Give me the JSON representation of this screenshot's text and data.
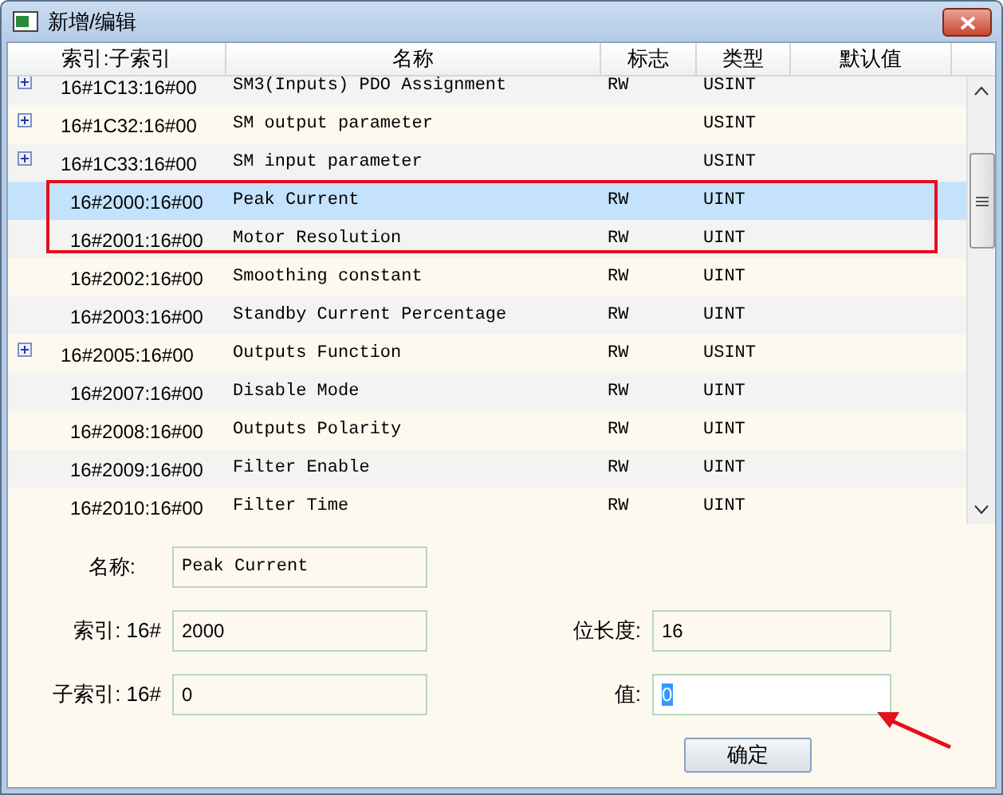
{
  "window": {
    "title": "新增/编辑"
  },
  "table": {
    "columns": [
      "索引:子索引",
      "名称",
      "标志",
      "类型",
      "默认值"
    ],
    "rows": [
      {
        "index": "16#1C13:16#00",
        "name": "SM3(Inputs) PDO Assignment",
        "flag": "RW",
        "type": "USINT",
        "expandable": true,
        "selected": false
      },
      {
        "index": "16#1C32:16#00",
        "name": "SM output parameter",
        "flag": "",
        "type": "USINT",
        "expandable": true,
        "selected": false
      },
      {
        "index": "16#1C33:16#00",
        "name": "SM input parameter",
        "flag": "",
        "type": "USINT",
        "expandable": true,
        "selected": false
      },
      {
        "index": "16#2000:16#00",
        "name": "Peak Current",
        "flag": "RW",
        "type": "UINT",
        "expandable": false,
        "selected": true
      },
      {
        "index": "16#2001:16#00",
        "name": "Motor Resolution",
        "flag": "RW",
        "type": "UINT",
        "expandable": false,
        "selected": false
      },
      {
        "index": "16#2002:16#00",
        "name": "Smoothing constant",
        "flag": "RW",
        "type": "UINT",
        "expandable": false,
        "selected": false
      },
      {
        "index": "16#2003:16#00",
        "name": "Standby Current Percentage",
        "flag": "RW",
        "type": "UINT",
        "expandable": false,
        "selected": false
      },
      {
        "index": "16#2005:16#00",
        "name": "Outputs Function",
        "flag": "RW",
        "type": "USINT",
        "expandable": true,
        "selected": false
      },
      {
        "index": "16#2007:16#00",
        "name": "Disable Mode",
        "flag": "RW",
        "type": "UINT",
        "expandable": false,
        "selected": false
      },
      {
        "index": "16#2008:16#00",
        "name": "Outputs Polarity",
        "flag": "RW",
        "type": "UINT",
        "expandable": false,
        "selected": false
      },
      {
        "index": "16#2009:16#00",
        "name": "Filter Enable",
        "flag": "RW",
        "type": "UINT",
        "expandable": false,
        "selected": false
      },
      {
        "index": "16#2010:16#00",
        "name": "Filter Time",
        "flag": "RW",
        "type": "UINT",
        "expandable": false,
        "selected": false
      }
    ]
  },
  "form": {
    "name_label": "名称:",
    "name_value": "Peak Current",
    "index_label": "索引: 16#",
    "index_value": "2000",
    "subindex_label": "子索引: 16#",
    "subindex_value": "0",
    "bitlength_label": "位长度:",
    "bitlength_value": "16",
    "value_label": "值:",
    "value_value": "0",
    "ok_button": "确定"
  }
}
